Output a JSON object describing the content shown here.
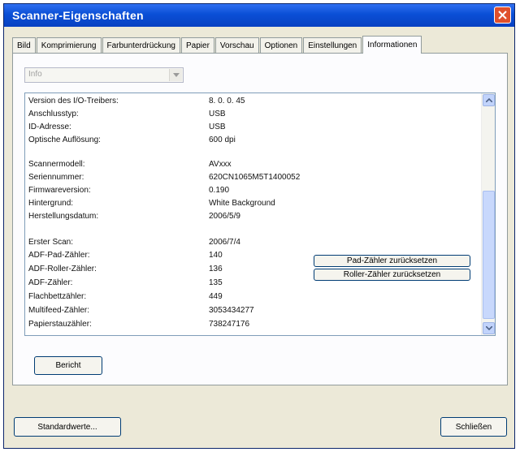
{
  "window": {
    "title": "Scanner-Eigenschaften"
  },
  "tabs": [
    "Bild",
    "Komprimierung",
    "Farbunterdrückung",
    "Papier",
    "Vorschau",
    "Optionen",
    "Einstellungen",
    "Informationen"
  ],
  "active_tab": "Informationen",
  "combo": {
    "value": "Info"
  },
  "info_rows": [
    {
      "label": "Version des I/O-Treibers:",
      "value": "8. 0. 0. 45"
    },
    {
      "label": "Anschlusstyp:",
      "value": "USB"
    },
    {
      "label": "ID-Adresse:",
      "value": "USB"
    },
    {
      "label": "Optische Auflösung:",
      "value": "600 dpi"
    },
    {
      "label": "Scannermodell:",
      "value": "AVxxx"
    },
    {
      "label": "Seriennummer:",
      "value": "620CN1065M5T1400052"
    },
    {
      "label": "Firmwareversion:",
      "value": "0.190"
    },
    {
      "label": "Hintergrund:",
      "value": "White Background"
    },
    {
      "label": "Herstellungsdatum:",
      "value": "2006/5/9"
    },
    {
      "label": "Erster Scan:",
      "value": "2006/7/4"
    },
    {
      "label": "ADF-Pad-Zähler:",
      "value": "140"
    },
    {
      "label": "ADF-Roller-Zähler:",
      "value": "136"
    },
    {
      "label": "ADF-Zähler:",
      "value": "135"
    },
    {
      "label": "Flachbettzähler:",
      "value": "449"
    },
    {
      "label": "Multifeed-Zähler:",
      "value": "3053434277"
    },
    {
      "label": "Papierstauzähler:",
      "value": "738247176"
    }
  ],
  "buttons": {
    "reset_pad": "Pad-Zähler zurücksetzen",
    "reset_roller": "Roller-Zähler zurücksetzen",
    "report": "Bericht",
    "defaults": "Standardwerte...",
    "close": "Schließen"
  },
  "icons": {
    "close": "close-icon",
    "dropdown": "chevron-down-icon",
    "scroll_up": "scroll-up-icon",
    "scroll_down": "scroll-down-icon"
  }
}
